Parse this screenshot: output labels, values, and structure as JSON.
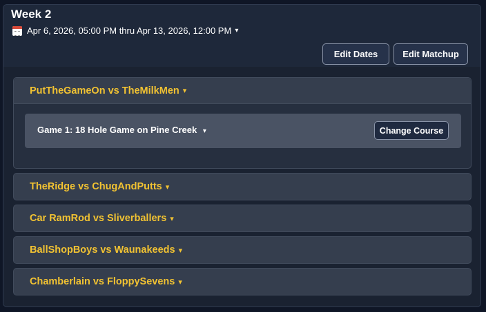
{
  "header": {
    "title": "Week 2",
    "date_range": "Apr 6, 2026, 05:00 PM thru Apr 13, 2026, 12:00 PM",
    "date_caret": "▾",
    "edit_dates_label": "Edit Dates",
    "edit_matchup_label": "Edit Matchup"
  },
  "matchups": [
    {
      "label": "PutTheGameOn vs TheMilkMen",
      "caret": "▾",
      "expanded": true,
      "games": [
        {
          "label": "Game 1: 18 Hole Game on Pine Creek",
          "caret": "▾",
          "change_course_label": "Change Course"
        }
      ]
    },
    {
      "label": "TheRidge vs ChugAndPutts",
      "caret": "▾",
      "expanded": false
    },
    {
      "label": "Car RamRod vs Sliverballers",
      "caret": "▾",
      "expanded": false
    },
    {
      "label": "BallShopBoys vs Waunakeeds",
      "caret": "▾",
      "expanded": false
    },
    {
      "label": "Chamberlain vs FloppySevens",
      "caret": "▾",
      "expanded": false
    }
  ],
  "colors": {
    "background": "#0f1626",
    "panel": "#1b2435",
    "matchup_text": "#f1c232",
    "matchup_bg": "#353e4e",
    "game_row_bg": "#4a5364"
  }
}
